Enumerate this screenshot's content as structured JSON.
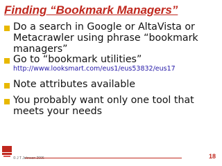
{
  "slide": {
    "title": "Finding “Bookmark Managers”",
    "bullets": [
      {
        "lines": [
          "Do a search in Google or AltaVista or",
          "Metacrawler using phrase “bookmark",
          "managers”"
        ]
      },
      {
        "lines": [
          "Go to “bookmark utilities”"
        ],
        "link": "http://www.looksmart.com/eus1/eus53832/eus17"
      },
      {
        "lines": [
          "Note attributes available"
        ]
      },
      {
        "lines": [
          "You probably want only one tool that",
          "meets your needs"
        ]
      }
    ],
    "footer": {
      "copyright": "© J T Johnson 2006",
      "page_number": "18"
    }
  },
  "colors": {
    "title": "#c0281e",
    "bullet": "#e8b800",
    "link": "#2418a8"
  }
}
